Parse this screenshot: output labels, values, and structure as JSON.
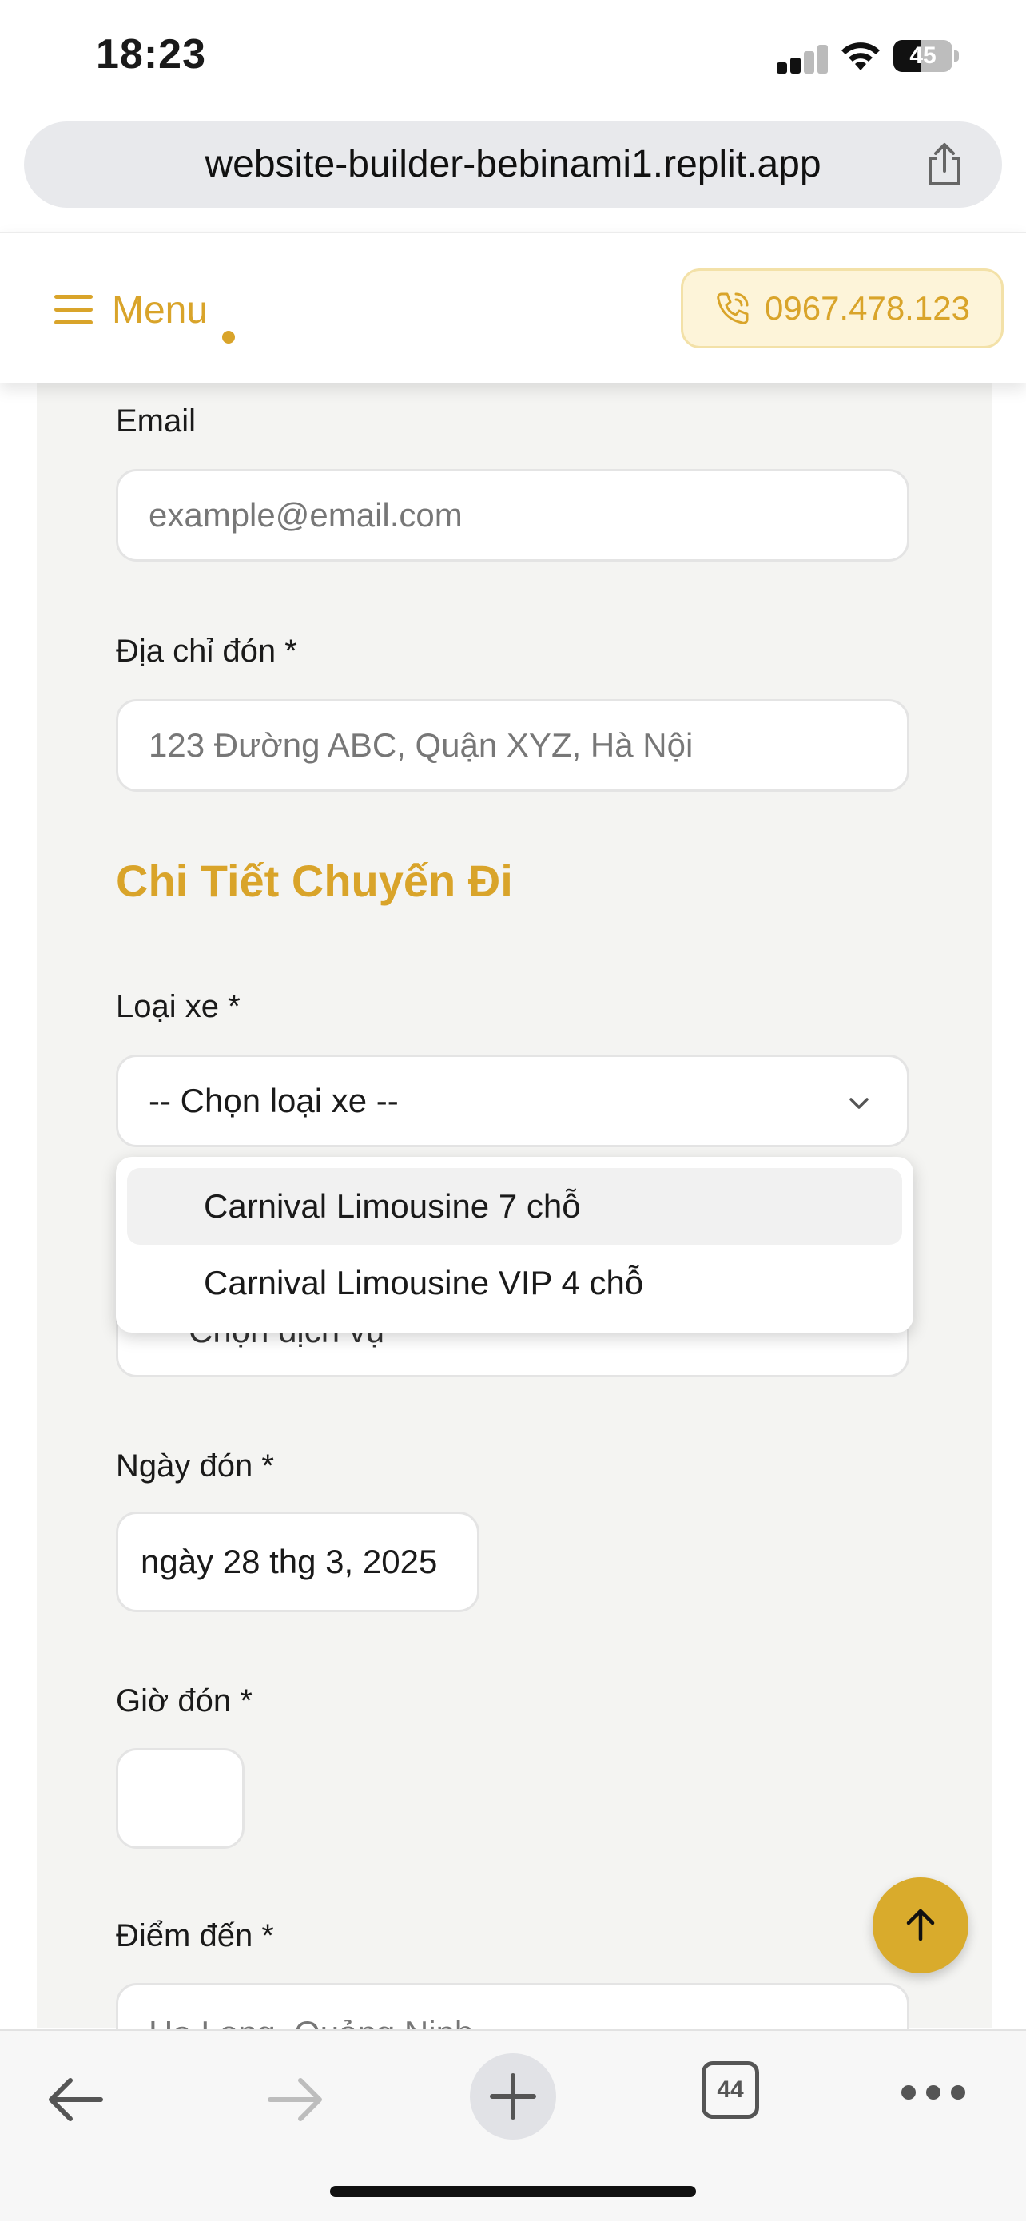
{
  "status_bar": {
    "time": "18:23",
    "battery_level": "45"
  },
  "browser": {
    "url": "website-builder-bebinami1.replit.app",
    "tabs_count": "44"
  },
  "header": {
    "menu_label": "Menu",
    "phone": "0967.478.123"
  },
  "form": {
    "email_label": "Email",
    "email_placeholder": "example@email.com",
    "pickup_address_label": "Địa chỉ đón *",
    "pickup_address_placeholder": "123 Đường ABC, Quận XYZ, Hà Nội",
    "trip_section_title": "Chi Tiết Chuyến Đi",
    "vehicle_label": "Loại xe *",
    "vehicle_selected": "-- Chọn loại xe --",
    "vehicle_options": [
      "Carnival Limousine 7 chỗ",
      "Carnival Limousine VIP 4 chỗ"
    ],
    "service_partial": "Chọn dịch vụ",
    "pickup_date_label": "Ngày đón *",
    "pickup_date_value": "ngày 28 thg 3, 2025",
    "pickup_time_label": "Giờ đón *",
    "destination_label": "Điểm đến *",
    "destination_placeholder": "Hạ Long, Quảng Ninh"
  },
  "colors": {
    "accent": "#d9a42a",
    "card_bg": "#f4f4f2"
  }
}
